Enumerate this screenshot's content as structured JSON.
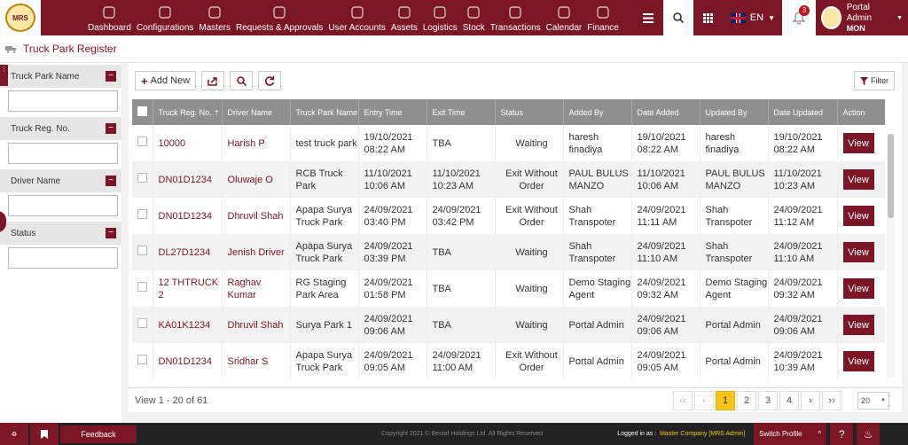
{
  "app": {
    "logo_text": "MRS"
  },
  "nav": [
    {
      "label": "Dashboard",
      "icon": "dashboard-icon"
    },
    {
      "label": "Configurations",
      "icon": "configurations-icon"
    },
    {
      "label": "Masters",
      "icon": "masters-icon"
    },
    {
      "label": "Requests & Approvals",
      "icon": "requests-icon"
    },
    {
      "label": "User Accounts",
      "icon": "user-accounts-icon"
    },
    {
      "label": "Assets",
      "icon": "assets-icon"
    },
    {
      "label": "Logistics",
      "icon": "logistics-icon"
    },
    {
      "label": "Stock",
      "icon": "stock-icon"
    },
    {
      "label": "Transactions",
      "icon": "transactions-icon"
    },
    {
      "label": "Calendar",
      "icon": "calendar-icon"
    },
    {
      "label": "Finance",
      "icon": "finance-icon"
    }
  ],
  "header": {
    "language": "EN",
    "notifications_count": "3",
    "user_name": "Portal Admin",
    "user_sub": "MON"
  },
  "page": {
    "title": "Truck Park Register"
  },
  "filters": [
    {
      "label": "Truck Park Name",
      "value": ""
    },
    {
      "label": "Truck Reg. No.",
      "value": ""
    },
    {
      "label": "Driver Name",
      "value": ""
    },
    {
      "label": "Status",
      "value": ""
    }
  ],
  "toolbar": {
    "add_label": "Add New",
    "filter_label": "Filter"
  },
  "table": {
    "columns": [
      "Truck Reg. No.",
      "Driver Name",
      "Truck Park Name",
      "Entry Time",
      "Exit Time",
      "Status",
      "Added By",
      "Date Added",
      "Updated By",
      "Date Updated",
      "Action"
    ],
    "action_label": "View",
    "rows": [
      [
        "10000",
        "Harish P",
        "test truck park",
        "19/10/2021 08:22 AM",
        "TBA",
        "Waiting",
        "haresh finadiya",
        "19/10/2021 08:22 AM",
        "haresh finadiya",
        "19/10/2021 08:22 AM"
      ],
      [
        "DN01D1234",
        "Oluwaje O",
        "RCB Truck Park",
        "11/10/2021 10:06 AM",
        "11/10/2021 10:23 AM",
        "Exit Without Order",
        "PAUL BULUS MANZO",
        "11/10/2021 10:06 AM",
        "PAUL BULUS MANZO",
        "11/10/2021 10:23 AM"
      ],
      [
        "DN01D1234",
        "Dhruvil Shah",
        "Apapa Surya Truck Park",
        "24/09/2021 03:40 PM",
        "24/09/2021 03:42 PM",
        "Exit Without Order",
        "Shah Transpoter",
        "24/09/2021 11:11 AM",
        "Shah Transpoter",
        "24/09/2021 11:12 AM"
      ],
      [
        "DL27D1234",
        "Jenish Driver",
        "Apapa Surya Truck Park",
        "24/09/2021 03:39 PM",
        "TBA",
        "Waiting",
        "Shah Transpoter",
        "24/09/2021 11:10 AM",
        "Shah Transpoter",
        "24/09/2021 11:10 AM"
      ],
      [
        "12 THTRUCK 2",
        "Raghav Kumar",
        "RG Staging Park Area",
        "24/09/2021 01:58 PM",
        "TBA",
        "Waiting",
        "Demo Staging Agent",
        "24/09/2021 09:32 AM",
        "Demo Staging Agent",
        "24/09/2021 09:32 AM"
      ],
      [
        "KA01K1234",
        "Dhruvil Shah",
        "Surya Park 1",
        "24/09/2021 09:06 AM",
        "TBA",
        "Waiting",
        "Portal Admin",
        "24/09/2021 09:06 AM",
        "Portal Admin",
        "24/09/2021 09:06 AM"
      ],
      [
        "DN01D1234",
        "Sridhar S",
        "Apapa Surya Truck Park",
        "24/09/2021 09:05 AM",
        "24/09/2021 11:00 AM",
        "Exit Without Order",
        "Portal Admin",
        "24/09/2021 09:05 AM",
        "Portal Admin",
        "24/09/2021 10:39 AM"
      ]
    ]
  },
  "pager": {
    "summary": "View 1 - 20 of 61",
    "first": "‹‹",
    "prev": "‹",
    "pages": [
      "1",
      "2",
      "3",
      "4"
    ],
    "next": "›",
    "last": "››",
    "page_size": "20"
  },
  "footer": {
    "feedback": "Feedback",
    "copyright": "Copyright 2021 © Bestaf Holdings Ltd. All Rights Reserved",
    "logged_in_label": "Logged in as :",
    "logged_in_value": "Master Company [MRS Admin]",
    "switch_profile": "Switch Profile"
  }
}
